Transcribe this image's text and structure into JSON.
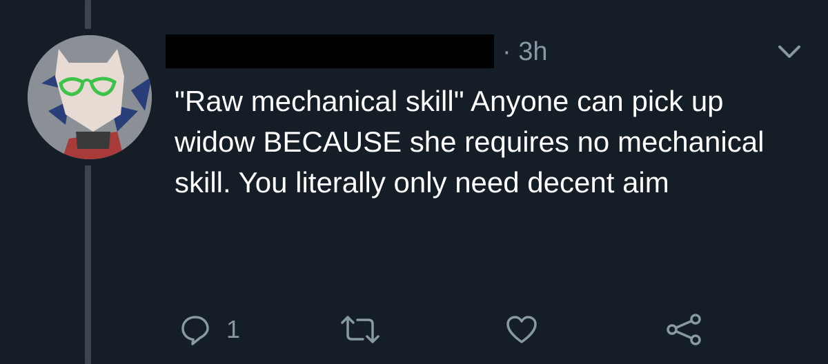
{
  "tweet": {
    "timestamp": "· 3h",
    "text": "\"Raw mechanical skill\" Anyone can pick up widow BECAUSE she requires no mechanical skill. You literally only need decent aim",
    "reply_count": "1"
  },
  "icons": {
    "menu": "chevron-down-icon",
    "reply": "reply-icon",
    "retweet": "retweet-icon",
    "like": "heart-icon",
    "share": "share-icon"
  },
  "colors": {
    "background": "#151d27",
    "secondary_text": "#8899a6",
    "thread_line": "#3a4653",
    "primary_text": "#ffffff"
  }
}
